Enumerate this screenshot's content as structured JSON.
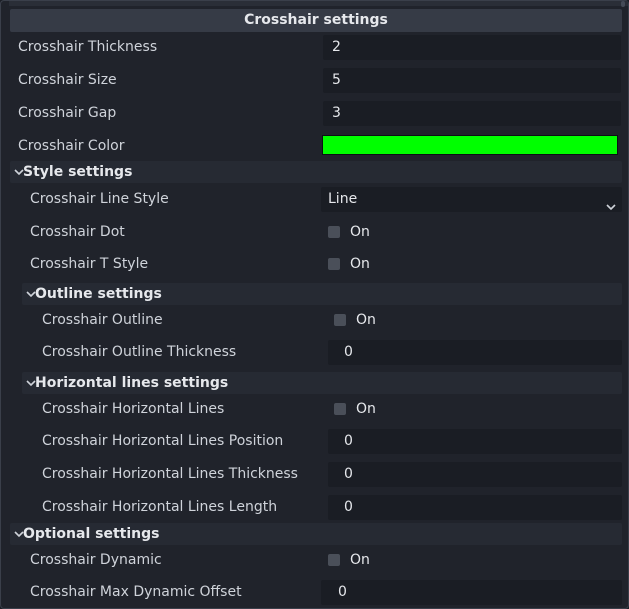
{
  "title": "Crosshair settings",
  "colors": {
    "crosshair_color": "#00ff00"
  },
  "rows": {
    "thickness": {
      "label": "Crosshair Thickness",
      "value": "2"
    },
    "size": {
      "label": "Crosshair Size",
      "value": "5"
    },
    "gap": {
      "label": "Crosshair Gap",
      "value": "3"
    },
    "color": {
      "label": "Crosshair Color"
    }
  },
  "style_section": {
    "title": "Style settings"
  },
  "style": {
    "line_style": {
      "label": "Crosshair Line Style",
      "value": "Line"
    },
    "dot": {
      "label": "Crosshair Dot",
      "check_label": "On",
      "checked": false
    },
    "t_style": {
      "label": "Crosshair T Style",
      "check_label": "On",
      "checked": false
    }
  },
  "outline_section": {
    "title": "Outline settings"
  },
  "outline": {
    "outline": {
      "label": "Crosshair Outline",
      "check_label": "On",
      "checked": false
    },
    "thickness": {
      "label": "Crosshair Outline Thickness",
      "value": "0"
    }
  },
  "horizontal_section": {
    "title": "Horizontal lines settings"
  },
  "horizontal": {
    "lines": {
      "label": "Crosshair Horizontal Lines",
      "check_label": "On",
      "checked": false
    },
    "position": {
      "label": "Crosshair Horizontal Lines Position",
      "value": "0"
    },
    "thickness": {
      "label": "Crosshair Horizontal Lines Thickness",
      "value": "0"
    },
    "length": {
      "label": "Crosshair Horizontal Lines Length",
      "value": "0"
    }
  },
  "optional_section": {
    "title": "Optional settings"
  },
  "optional": {
    "dynamic": {
      "label": "Crosshair Dynamic",
      "check_label": "On",
      "checked": false
    },
    "max_offset": {
      "label": "Crosshair Max Dynamic Offset",
      "value": "0"
    }
  }
}
